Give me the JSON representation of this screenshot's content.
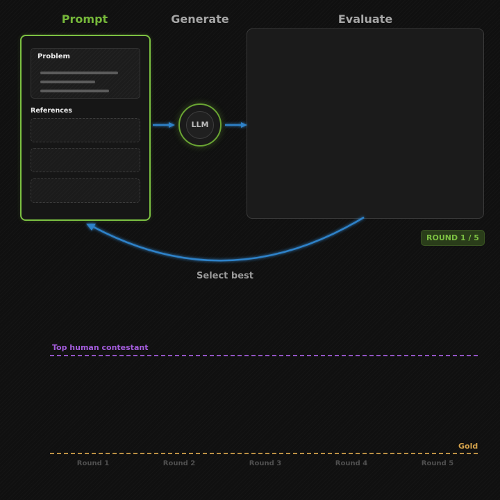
{
  "stages": {
    "prompt": "Prompt",
    "generate": "Generate",
    "evaluate": "Evaluate"
  },
  "prompt_panel": {
    "problem_title": "Problem",
    "references_title": "References"
  },
  "llm": {
    "label": "LLM"
  },
  "round_badge": "ROUND 1 / 5",
  "feedback_label": "Select best",
  "progress": {
    "top_human_label": "Top human contestant",
    "gold_label": "Gold",
    "rounds": [
      "Round 1",
      "Round 2",
      "Round 3",
      "Round 4",
      "Round 5"
    ]
  },
  "colors": {
    "prompt_accent": "#7cc142",
    "arrow_blue": "#2f82c9",
    "human_purple": "#a45ddd",
    "gold": "#d4a24b",
    "background": "#101010"
  }
}
